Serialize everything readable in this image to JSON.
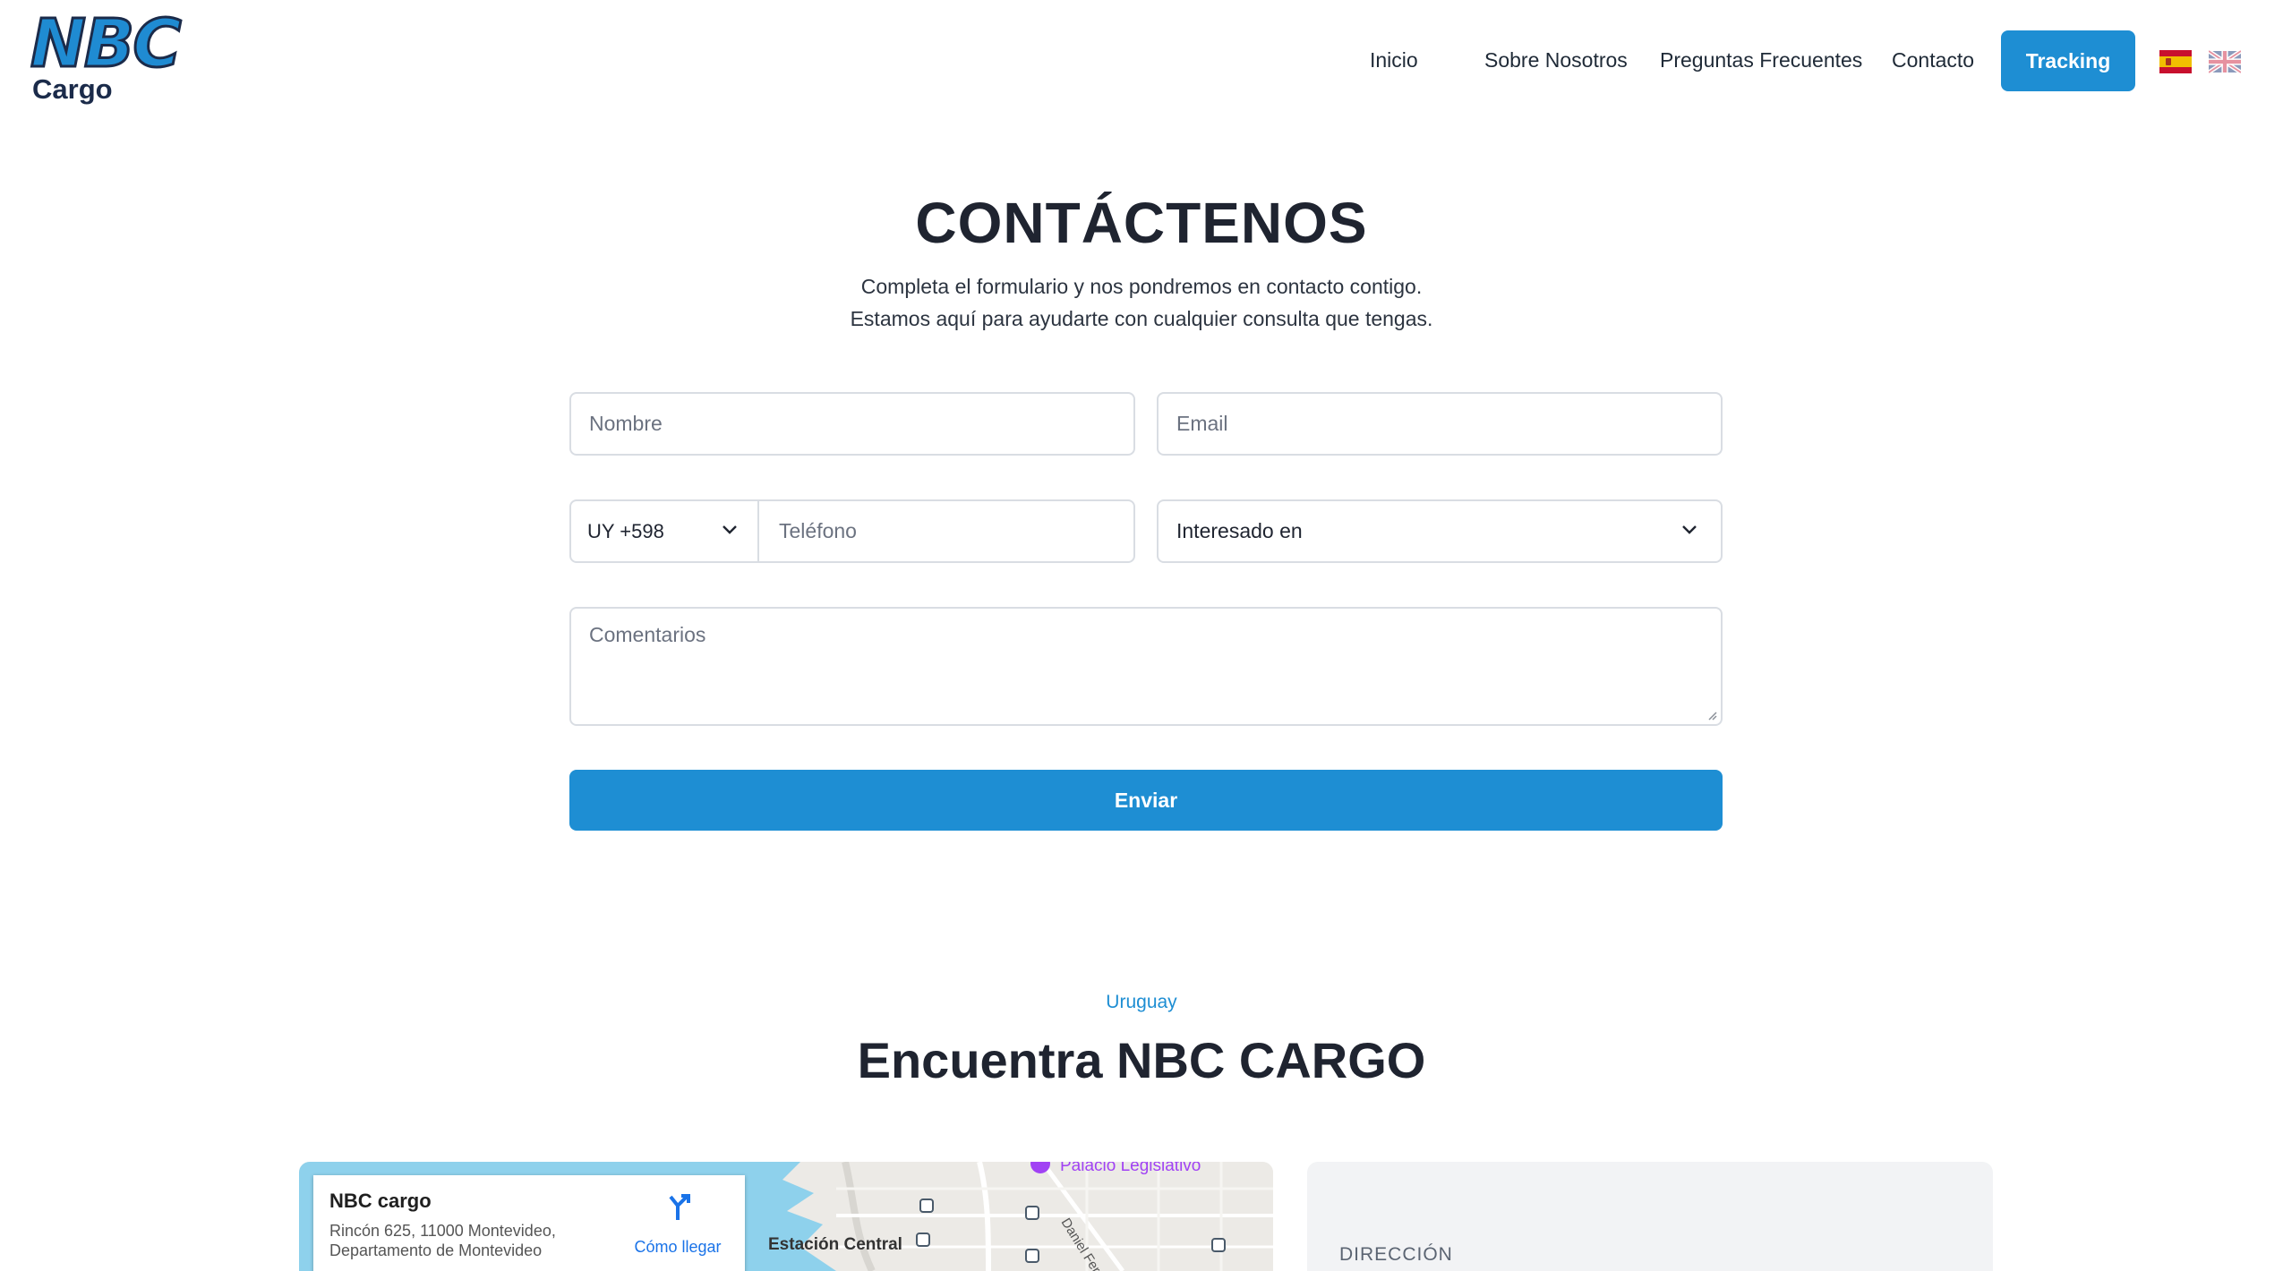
{
  "brand": {
    "logo_main": "NBC",
    "logo_sub": "Cargo"
  },
  "nav": {
    "items": [
      {
        "label": "Inicio"
      },
      {
        "label": "Sobre Nosotros"
      },
      {
        "label": "Preguntas Frecuentes"
      },
      {
        "label": "Contacto"
      }
    ],
    "tracking_label": "Tracking",
    "languages": [
      {
        "code": "es",
        "icon": "flag-spain-icon"
      },
      {
        "code": "en",
        "icon": "flag-uk-icon"
      }
    ],
    "accent_color": "#1e8ed3"
  },
  "contact": {
    "title": "CONTÁCTENOS",
    "subtitle_line1": "Completa el formulario y nos pondremos en contacto contigo.",
    "subtitle_line2": "Estamos aquí para ayudarte con cualquier consulta que tengas.",
    "form": {
      "name_placeholder": "Nombre",
      "email_placeholder": "Email",
      "country_code_value": "UY +598",
      "phone_placeholder": "Teléfono",
      "interest_value": "Interesado en",
      "comments_placeholder": "Comentarios",
      "submit_label": "Enviar"
    }
  },
  "location": {
    "eyebrow": "Uruguay",
    "title": "Encuentra NBC CARGO",
    "map": {
      "place_name": "NBC cargo",
      "address_line1": "Rincón 625, 11000 Montevideo,",
      "address_line2": "Departamento de Montevideo",
      "directions_label": "Cómo llegar",
      "label_station": "Estación Central",
      "label_palace": "Palacio Legislativo",
      "label_street": "Daniel Fern"
    },
    "info": {
      "address_heading": "DIRECCIÓN"
    }
  }
}
